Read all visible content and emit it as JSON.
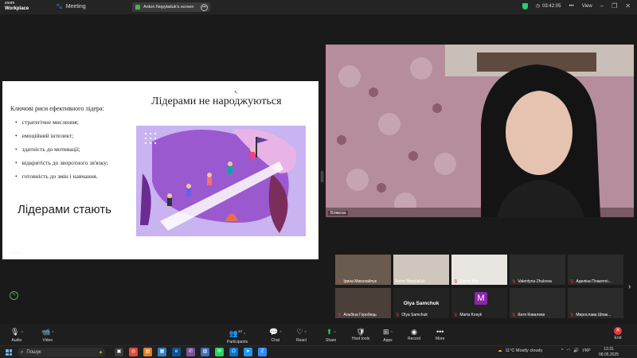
{
  "app": {
    "brand_line1": "zoom",
    "brand_line2": "Workplace",
    "meeting_label": "Meeting",
    "share_pill": "Anton Nepytaliuk's screen",
    "timer": "03:42:05",
    "view_label": "View"
  },
  "slide": {
    "subtitle": "Ключові риси ефективного лідера:",
    "bullets": [
      "стратегічне мислення;",
      "емоційний інтелект;",
      "здатність до мотивації;",
      "відкритість до зворотного зв'язку;",
      "готовність до змін і навчання."
    ],
    "title": "Лідерами не народжуються",
    "big_text": "Лідерами стають"
  },
  "speaker": {
    "name": "Божєна"
  },
  "gallery": [
    {
      "name": "Ірина Миколайчук",
      "muted": true,
      "bg": "#6b5a4e"
    },
    {
      "name": "Anton Nepytaliuk",
      "muted": false,
      "bg": "#cfc7bd"
    },
    {
      "name": "Serhiy Bai",
      "muted": true,
      "bg": "#e9e6e1"
    },
    {
      "name": "Valentyna Zhukova",
      "muted": true,
      "bg": "#2b2b2b"
    },
    {
      "name": "Аделіна Плакотні...",
      "muted": true,
      "bg": "#2a2a2a"
    },
    {
      "name": "Альбіна Горобець",
      "muted": true,
      "bg": "#4b3f3a"
    },
    {
      "name": "Olya Samchuk",
      "muted": true,
      "bg": "#232323",
      "center": "Olya Samchuk"
    },
    {
      "name": "Marta Kosyk",
      "muted": true,
      "bg": "#232323",
      "avatar": "M"
    },
    {
      "name": "Катя Ковалева",
      "muted": true,
      "bg": "#2a2a2a"
    },
    {
      "name": "Мирослава Шпак...",
      "muted": true,
      "bg": "#2a2a2a"
    }
  ],
  "toolbar": {
    "audio": "Audio",
    "video": "Video",
    "participants": "Participants",
    "participants_count": "40",
    "chat": "Chat",
    "react": "React",
    "share": "Share",
    "host_tools": "Host tools",
    "apps": "Apps",
    "record": "Record",
    "more": "More",
    "end": "End"
  },
  "taskbar": {
    "search_placeholder": "Пошук",
    "weather": "11°C  Mostly cloudy",
    "lang": "УКР",
    "time": "13:31",
    "date": "08.05.2025"
  },
  "colors": {
    "accent_green": "#2ecc71",
    "end_red": "#e53935",
    "art_purple": "#b9a0e6"
  }
}
